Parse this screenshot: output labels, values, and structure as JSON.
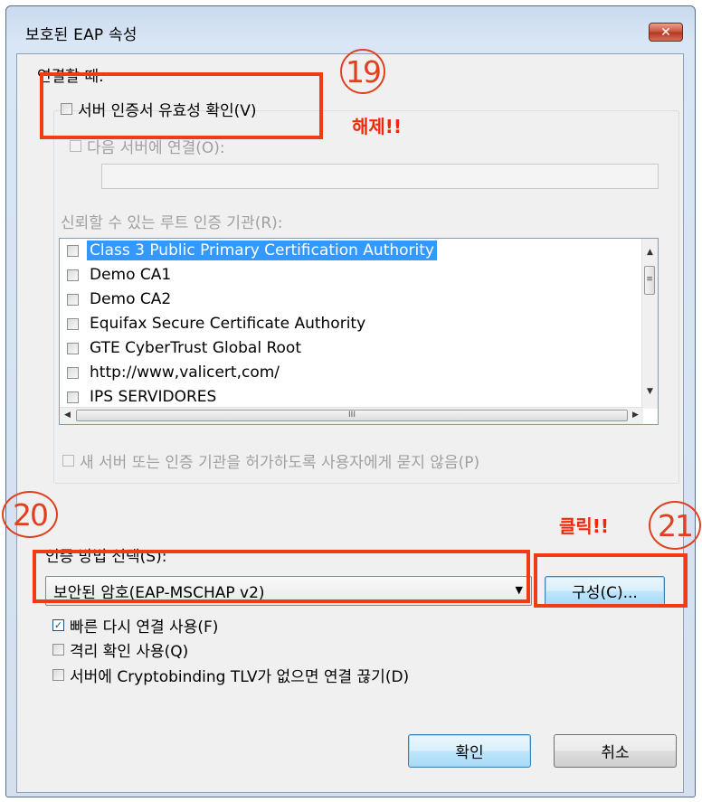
{
  "window": {
    "title": "보호된 EAP 속성",
    "close_glyph": "✕"
  },
  "connect_group": {
    "label": "연결할 때:",
    "validate_cert": "서버 인증서 유효성 확인(V)",
    "connect_servers": "다음 서버에 연결(O):",
    "trusted_root_label": "신뢰할 수 있는 루트 인증 기관(R):",
    "ca_list": [
      {
        "label": "Class 3 Public Primary Certification Authority",
        "selected": true
      },
      {
        "label": "Demo CA1",
        "selected": false
      },
      {
        "label": "Demo CA2",
        "selected": false
      },
      {
        "label": "Equifax Secure Certificate Authority",
        "selected": false
      },
      {
        "label": "GTE CyberTrust Global Root",
        "selected": false
      },
      {
        "label": "http://www,valicert,com/",
        "selected": false
      },
      {
        "label": "IPS SERVIDORES",
        "selected": false
      }
    ],
    "dont_prompt": "새 서버 또는 인증 기관을 허가하도록 사용자에게 묻지 않음(P)"
  },
  "auth_method": {
    "label": "인증 방법 선택(S):",
    "selected": "보안된 암호(EAP-MSCHAP v2)",
    "configure_button": "구성(C)..."
  },
  "options": {
    "fast_reconnect": {
      "label": "빠른 다시 연결 사용(F)",
      "checked": true
    },
    "quarantine": {
      "label": "격리 확인 사용(Q)",
      "checked": false
    },
    "cryptobinding": {
      "label": "서버에 Cryptobinding TLV가 없으면 연결 끊기(D)",
      "checked": false
    }
  },
  "buttons": {
    "ok": "확인",
    "cancel": "취소"
  },
  "annotations": {
    "step19": "19",
    "step19_note": "해제!!",
    "step20": "20",
    "step21": "21",
    "step21_note": "클릭!!",
    "color": "#f03c14"
  }
}
